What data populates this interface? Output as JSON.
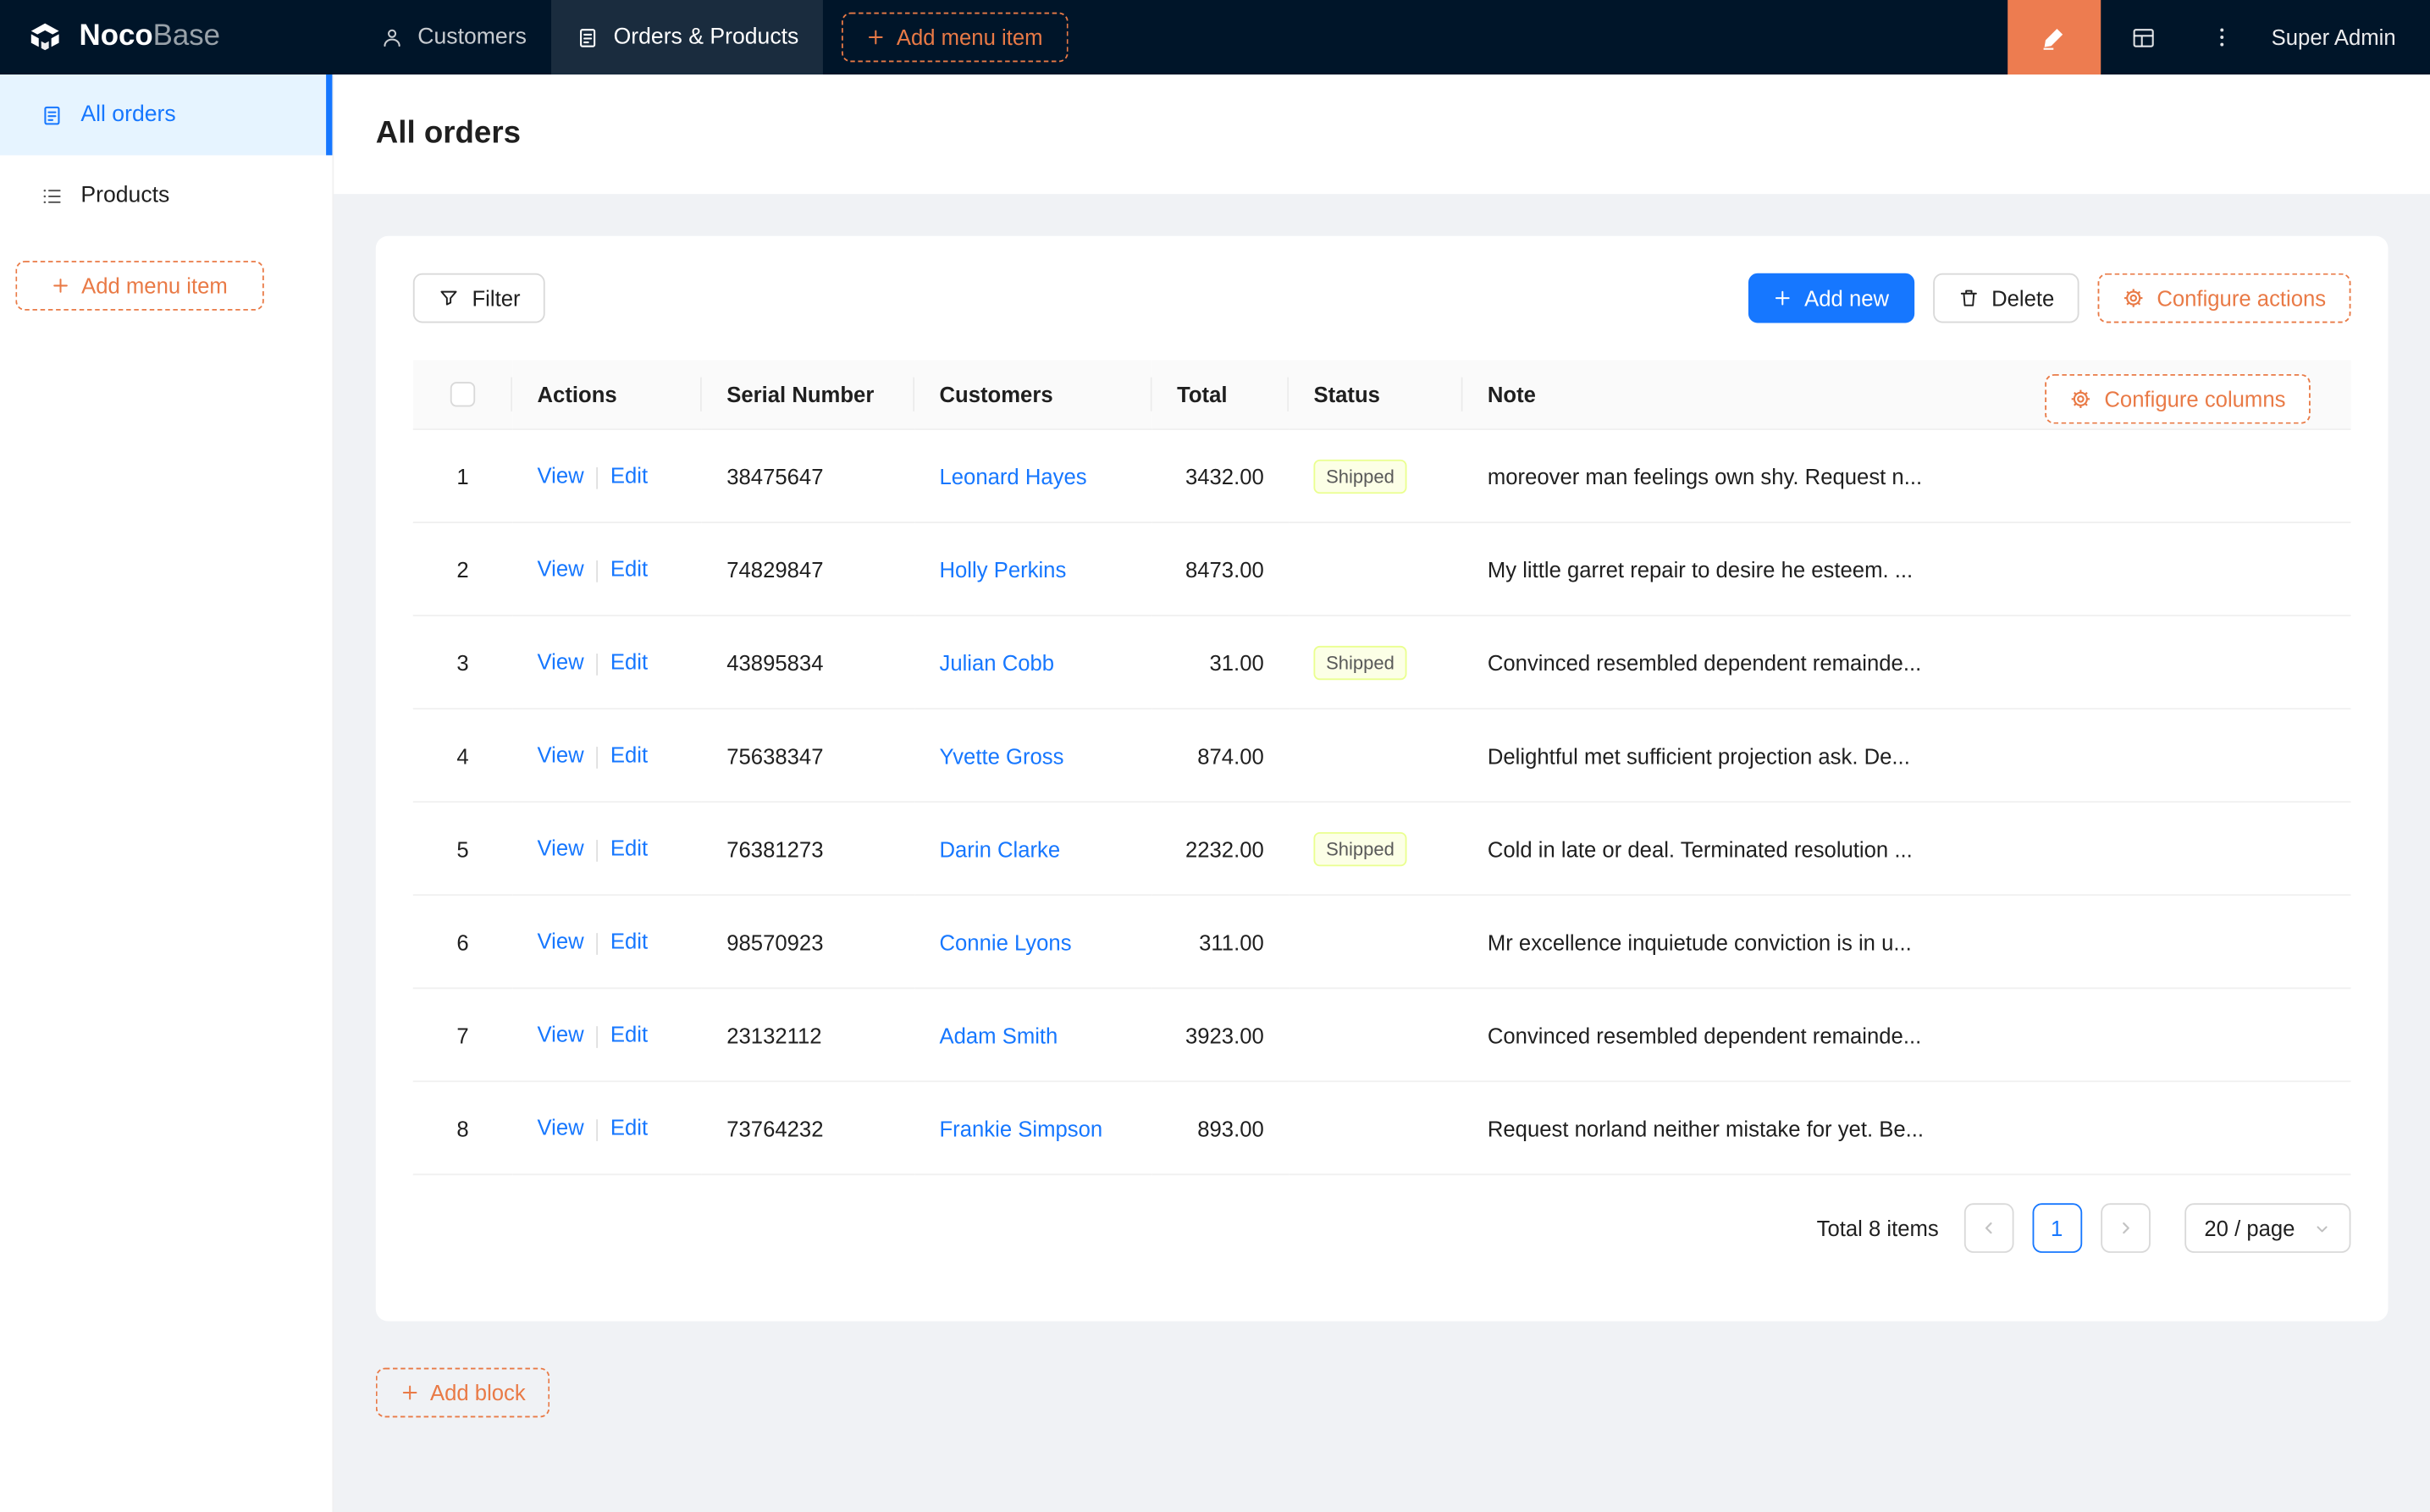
{
  "navbar": {
    "logo": {
      "noco": "Noco",
      "base": "Base"
    },
    "items": [
      {
        "label": "Customers"
      },
      {
        "label": "Orders & Products"
      }
    ],
    "add_menu_item": "+",
    "add_menu_item_label": "Add menu item",
    "user": "Super Admin"
  },
  "sidebar": {
    "items": [
      {
        "label": "All orders"
      },
      {
        "label": "Products"
      }
    ],
    "add_menu_item_label": "Add menu item"
  },
  "page": {
    "title": "All orders"
  },
  "toolbar": {
    "filter": "Filter",
    "add_new": "Add new",
    "delete": "Delete",
    "configure_actions": "Configure actions"
  },
  "table": {
    "configure_columns": "Configure columns",
    "columns": [
      "Actions",
      "Serial Number",
      "Customers",
      "Total",
      "Status",
      "Note"
    ],
    "actions": {
      "view": "View",
      "edit": "Edit"
    },
    "rows": [
      {
        "index": 1,
        "serial": "38475647",
        "customer": "Leonard Hayes",
        "total": "3432.00",
        "status": "Shipped",
        "note": "moreover man feelings own shy. Request n..."
      },
      {
        "index": 2,
        "serial": "74829847",
        "customer": "Holly Perkins",
        "total": "8473.00",
        "status": "",
        "note": "My little garret repair to desire he esteem. ..."
      },
      {
        "index": 3,
        "serial": "43895834",
        "customer": "Julian Cobb",
        "total": "31.00",
        "status": "Shipped",
        "note": "Convinced resembled dependent remainde..."
      },
      {
        "index": 4,
        "serial": "75638347",
        "customer": "Yvette Gross",
        "total": "874.00",
        "status": "",
        "note": "Delightful met sufficient projection ask. De..."
      },
      {
        "index": 5,
        "serial": "76381273",
        "customer": "Darin Clarke",
        "total": "2232.00",
        "status": "Shipped",
        "note": "Cold in late or deal. Terminated resolution ..."
      },
      {
        "index": 6,
        "serial": "98570923",
        "customer": "Connie Lyons",
        "total": "311.00",
        "status": "",
        "note": "Mr excellence inquietude conviction is in u..."
      },
      {
        "index": 7,
        "serial": "23132112",
        "customer": "Adam Smith",
        "total": "3923.00",
        "status": "",
        "note": "Convinced resembled dependent remainde..."
      },
      {
        "index": 8,
        "serial": "73764232",
        "customer": "Frankie Simpson",
        "total": "893.00",
        "status": "",
        "note": "Request norland neither mistake for yet. Be..."
      }
    ]
  },
  "pagination": {
    "total": "Total 8 items",
    "page": "1",
    "page_size": "20 / page"
  },
  "footer": {
    "add_block_label": "Add block"
  },
  "colors": {
    "navbar_bg": "#001529",
    "accent_orange_fill": "#ed7c50",
    "accent_orange_dashed": "#e97a46",
    "primary_blue": "#1677ff",
    "sidebar_active_bg": "#e6f4ff",
    "tag_shipped_bg": "#fcffe6",
    "tag_shipped_border": "#eaff8f",
    "content_bg": "#f0f2f5"
  },
  "icons": {
    "logo": "nocobase-cube-icon",
    "customers_tab": "user-icon",
    "orders_tab": "file-icon",
    "designer": "highlighter-icon",
    "collections": "table-grid-icon",
    "more": "kebab-icon",
    "filter": "funnel-icon",
    "delete": "trash-icon",
    "configure": "gear-icon",
    "select": "chevron-down-icon"
  }
}
